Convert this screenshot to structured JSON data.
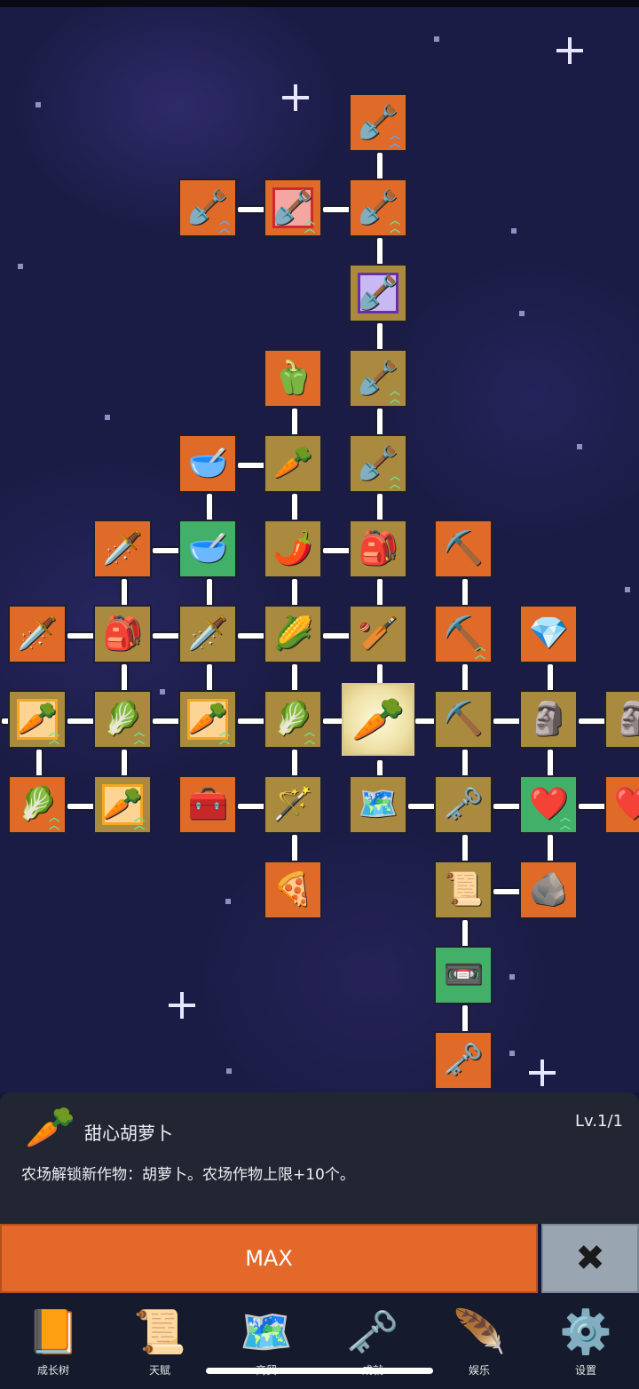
{
  "skill_tree": {
    "nodes": [
      {
        "id": "n1",
        "icon": "🪏",
        "bg": "orange",
        "arrows": "blue"
      },
      {
        "id": "n2",
        "icon": "🪏",
        "bg": "orange",
        "arrows": "blue"
      },
      {
        "id": "n3",
        "icon": "🪏",
        "bg": "orange",
        "frame": "red",
        "arrows": "green"
      },
      {
        "id": "n4",
        "icon": "🪏",
        "bg": "orange",
        "arrows": "green"
      },
      {
        "id": "n5",
        "icon": "🪏",
        "bg": "tan",
        "frame": "purple"
      },
      {
        "id": "n6",
        "icon": "🫑",
        "bg": "orange"
      },
      {
        "id": "n7",
        "icon": "🪏",
        "bg": "tan",
        "arrows": "green"
      },
      {
        "id": "n8",
        "icon": "🥣",
        "bg": "orange"
      },
      {
        "id": "n9",
        "icon": "🥕",
        "bg": "tan"
      },
      {
        "id": "n10",
        "icon": "🪏",
        "bg": "tan",
        "arrows": "green"
      },
      {
        "id": "n11",
        "icon": "🗡️",
        "bg": "orange"
      },
      {
        "id": "n12",
        "icon": "🥣",
        "bg": "green"
      },
      {
        "id": "n13",
        "icon": "🌶️",
        "bg": "tan"
      },
      {
        "id": "n14",
        "icon": "🎒",
        "bg": "tan"
      },
      {
        "id": "n15",
        "icon": "⛏️",
        "bg": "orange"
      },
      {
        "id": "n16",
        "icon": "🗡️",
        "bg": "orange"
      },
      {
        "id": "n17",
        "icon": "🎒",
        "bg": "tan"
      },
      {
        "id": "n18",
        "icon": "🗡️",
        "bg": "tan"
      },
      {
        "id": "n19",
        "icon": "🌽",
        "bg": "tan"
      },
      {
        "id": "n20",
        "icon": "🏏",
        "bg": "tan"
      },
      {
        "id": "n21",
        "icon": "⛏️",
        "bg": "orange",
        "arrows": "green"
      },
      {
        "id": "n22",
        "icon": "💎",
        "bg": "orange"
      },
      {
        "id": "n23",
        "icon": "🥕",
        "bg": "tan",
        "frame": "yellow",
        "arrows": "green"
      },
      {
        "id": "n24",
        "icon": "🥬",
        "bg": "tan",
        "arrows": "green"
      },
      {
        "id": "n25",
        "icon": "🥕",
        "bg": "tan",
        "frame": "yellow",
        "arrows": "green"
      },
      {
        "id": "n26",
        "icon": "🥬",
        "bg": "tan",
        "arrows": "green"
      },
      {
        "id": "n27",
        "icon": "🥕",
        "bg": "selected"
      },
      {
        "id": "n28",
        "icon": "⛏️",
        "bg": "tan"
      },
      {
        "id": "n29",
        "icon": "🗿",
        "bg": "tan"
      },
      {
        "id": "n30",
        "icon": "🗿",
        "bg": "tan"
      },
      {
        "id": "n31",
        "icon": "🥬",
        "bg": "orange",
        "arrows": "green"
      },
      {
        "id": "n32",
        "icon": "🥕",
        "bg": "tan",
        "frame": "yellow",
        "arrows": "green"
      },
      {
        "id": "n33",
        "icon": "🧰",
        "bg": "orange"
      },
      {
        "id": "n34",
        "icon": "🪄",
        "bg": "tan"
      },
      {
        "id": "n35",
        "icon": "🗺️",
        "bg": "tan"
      },
      {
        "id": "n36",
        "icon": "🗝️",
        "bg": "tan"
      },
      {
        "id": "n37",
        "icon": "❤️",
        "bg": "green",
        "arrows": "green"
      },
      {
        "id": "n38",
        "icon": "❤️",
        "bg": "orange"
      },
      {
        "id": "n39",
        "icon": "🍕",
        "bg": "orange"
      },
      {
        "id": "n40",
        "icon": "📜",
        "bg": "tan"
      },
      {
        "id": "n41",
        "icon": "🪨",
        "bg": "orange"
      },
      {
        "id": "n42",
        "icon": "📼",
        "bg": "green"
      },
      {
        "id": "n43",
        "icon": "🗝️",
        "bg": "orange"
      }
    ]
  },
  "selected_skill": {
    "icon": "🥕",
    "name": "甜心胡萝卜",
    "level": "Lv.1/1",
    "description": "农场解锁新作物：胡萝卜。农场作物上限+10个。"
  },
  "actions": {
    "max_label": "MAX",
    "close_icon": "close-icon"
  },
  "bottom_nav": [
    {
      "icon": "📙",
      "label": "成长树"
    },
    {
      "icon": "📜",
      "label": "天赋"
    },
    {
      "icon": "🗺️",
      "label": "商贸"
    },
    {
      "icon": "🗝️",
      "label": "成就"
    },
    {
      "icon": "🪶",
      "label": "娱乐"
    },
    {
      "icon": "⚙️",
      "label": "设置"
    }
  ],
  "colors": {
    "node_orange": "#e06a27",
    "node_tan": "#a98a3e",
    "node_green": "#43b06a",
    "max_button": "#e3682a",
    "close_button": "#9aa5b2",
    "panel": "#222633",
    "space": "#1b1c46"
  }
}
